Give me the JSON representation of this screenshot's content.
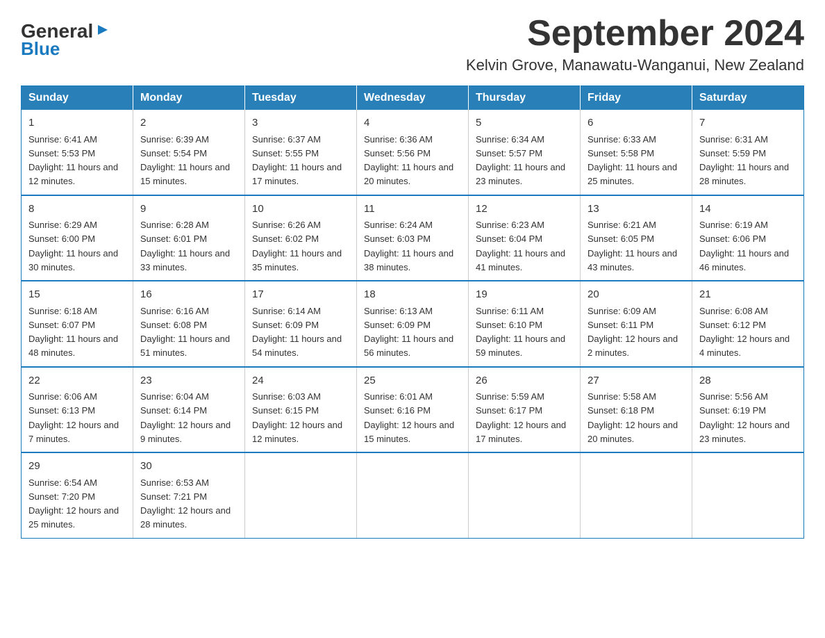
{
  "logo": {
    "general": "General",
    "blue": "Blue",
    "arrow": "▶"
  },
  "title": "September 2024",
  "subtitle": "Kelvin Grove, Manawatu-Wanganui, New Zealand",
  "days_of_week": [
    "Sunday",
    "Monday",
    "Tuesday",
    "Wednesday",
    "Thursday",
    "Friday",
    "Saturday"
  ],
  "weeks": [
    [
      {
        "day": "1",
        "sunrise": "6:41 AM",
        "sunset": "5:53 PM",
        "daylight": "11 hours and 12 minutes."
      },
      {
        "day": "2",
        "sunrise": "6:39 AM",
        "sunset": "5:54 PM",
        "daylight": "11 hours and 15 minutes."
      },
      {
        "day": "3",
        "sunrise": "6:37 AM",
        "sunset": "5:55 PM",
        "daylight": "11 hours and 17 minutes."
      },
      {
        "day": "4",
        "sunrise": "6:36 AM",
        "sunset": "5:56 PM",
        "daylight": "11 hours and 20 minutes."
      },
      {
        "day": "5",
        "sunrise": "6:34 AM",
        "sunset": "5:57 PM",
        "daylight": "11 hours and 23 minutes."
      },
      {
        "day": "6",
        "sunrise": "6:33 AM",
        "sunset": "5:58 PM",
        "daylight": "11 hours and 25 minutes."
      },
      {
        "day": "7",
        "sunrise": "6:31 AM",
        "sunset": "5:59 PM",
        "daylight": "11 hours and 28 minutes."
      }
    ],
    [
      {
        "day": "8",
        "sunrise": "6:29 AM",
        "sunset": "6:00 PM",
        "daylight": "11 hours and 30 minutes."
      },
      {
        "day": "9",
        "sunrise": "6:28 AM",
        "sunset": "6:01 PM",
        "daylight": "11 hours and 33 minutes."
      },
      {
        "day": "10",
        "sunrise": "6:26 AM",
        "sunset": "6:02 PM",
        "daylight": "11 hours and 35 minutes."
      },
      {
        "day": "11",
        "sunrise": "6:24 AM",
        "sunset": "6:03 PM",
        "daylight": "11 hours and 38 minutes."
      },
      {
        "day": "12",
        "sunrise": "6:23 AM",
        "sunset": "6:04 PM",
        "daylight": "11 hours and 41 minutes."
      },
      {
        "day": "13",
        "sunrise": "6:21 AM",
        "sunset": "6:05 PM",
        "daylight": "11 hours and 43 minutes."
      },
      {
        "day": "14",
        "sunrise": "6:19 AM",
        "sunset": "6:06 PM",
        "daylight": "11 hours and 46 minutes."
      }
    ],
    [
      {
        "day": "15",
        "sunrise": "6:18 AM",
        "sunset": "6:07 PM",
        "daylight": "11 hours and 48 minutes."
      },
      {
        "day": "16",
        "sunrise": "6:16 AM",
        "sunset": "6:08 PM",
        "daylight": "11 hours and 51 minutes."
      },
      {
        "day": "17",
        "sunrise": "6:14 AM",
        "sunset": "6:09 PM",
        "daylight": "11 hours and 54 minutes."
      },
      {
        "day": "18",
        "sunrise": "6:13 AM",
        "sunset": "6:09 PM",
        "daylight": "11 hours and 56 minutes."
      },
      {
        "day": "19",
        "sunrise": "6:11 AM",
        "sunset": "6:10 PM",
        "daylight": "11 hours and 59 minutes."
      },
      {
        "day": "20",
        "sunrise": "6:09 AM",
        "sunset": "6:11 PM",
        "daylight": "12 hours and 2 minutes."
      },
      {
        "day": "21",
        "sunrise": "6:08 AM",
        "sunset": "6:12 PM",
        "daylight": "12 hours and 4 minutes."
      }
    ],
    [
      {
        "day": "22",
        "sunrise": "6:06 AM",
        "sunset": "6:13 PM",
        "daylight": "12 hours and 7 minutes."
      },
      {
        "day": "23",
        "sunrise": "6:04 AM",
        "sunset": "6:14 PM",
        "daylight": "12 hours and 9 minutes."
      },
      {
        "day": "24",
        "sunrise": "6:03 AM",
        "sunset": "6:15 PM",
        "daylight": "12 hours and 12 minutes."
      },
      {
        "day": "25",
        "sunrise": "6:01 AM",
        "sunset": "6:16 PM",
        "daylight": "12 hours and 15 minutes."
      },
      {
        "day": "26",
        "sunrise": "5:59 AM",
        "sunset": "6:17 PM",
        "daylight": "12 hours and 17 minutes."
      },
      {
        "day": "27",
        "sunrise": "5:58 AM",
        "sunset": "6:18 PM",
        "daylight": "12 hours and 20 minutes."
      },
      {
        "day": "28",
        "sunrise": "5:56 AM",
        "sunset": "6:19 PM",
        "daylight": "12 hours and 23 minutes."
      }
    ],
    [
      {
        "day": "29",
        "sunrise": "6:54 AM",
        "sunset": "7:20 PM",
        "daylight": "12 hours and 25 minutes."
      },
      {
        "day": "30",
        "sunrise": "6:53 AM",
        "sunset": "7:21 PM",
        "daylight": "12 hours and 28 minutes."
      },
      null,
      null,
      null,
      null,
      null
    ]
  ]
}
